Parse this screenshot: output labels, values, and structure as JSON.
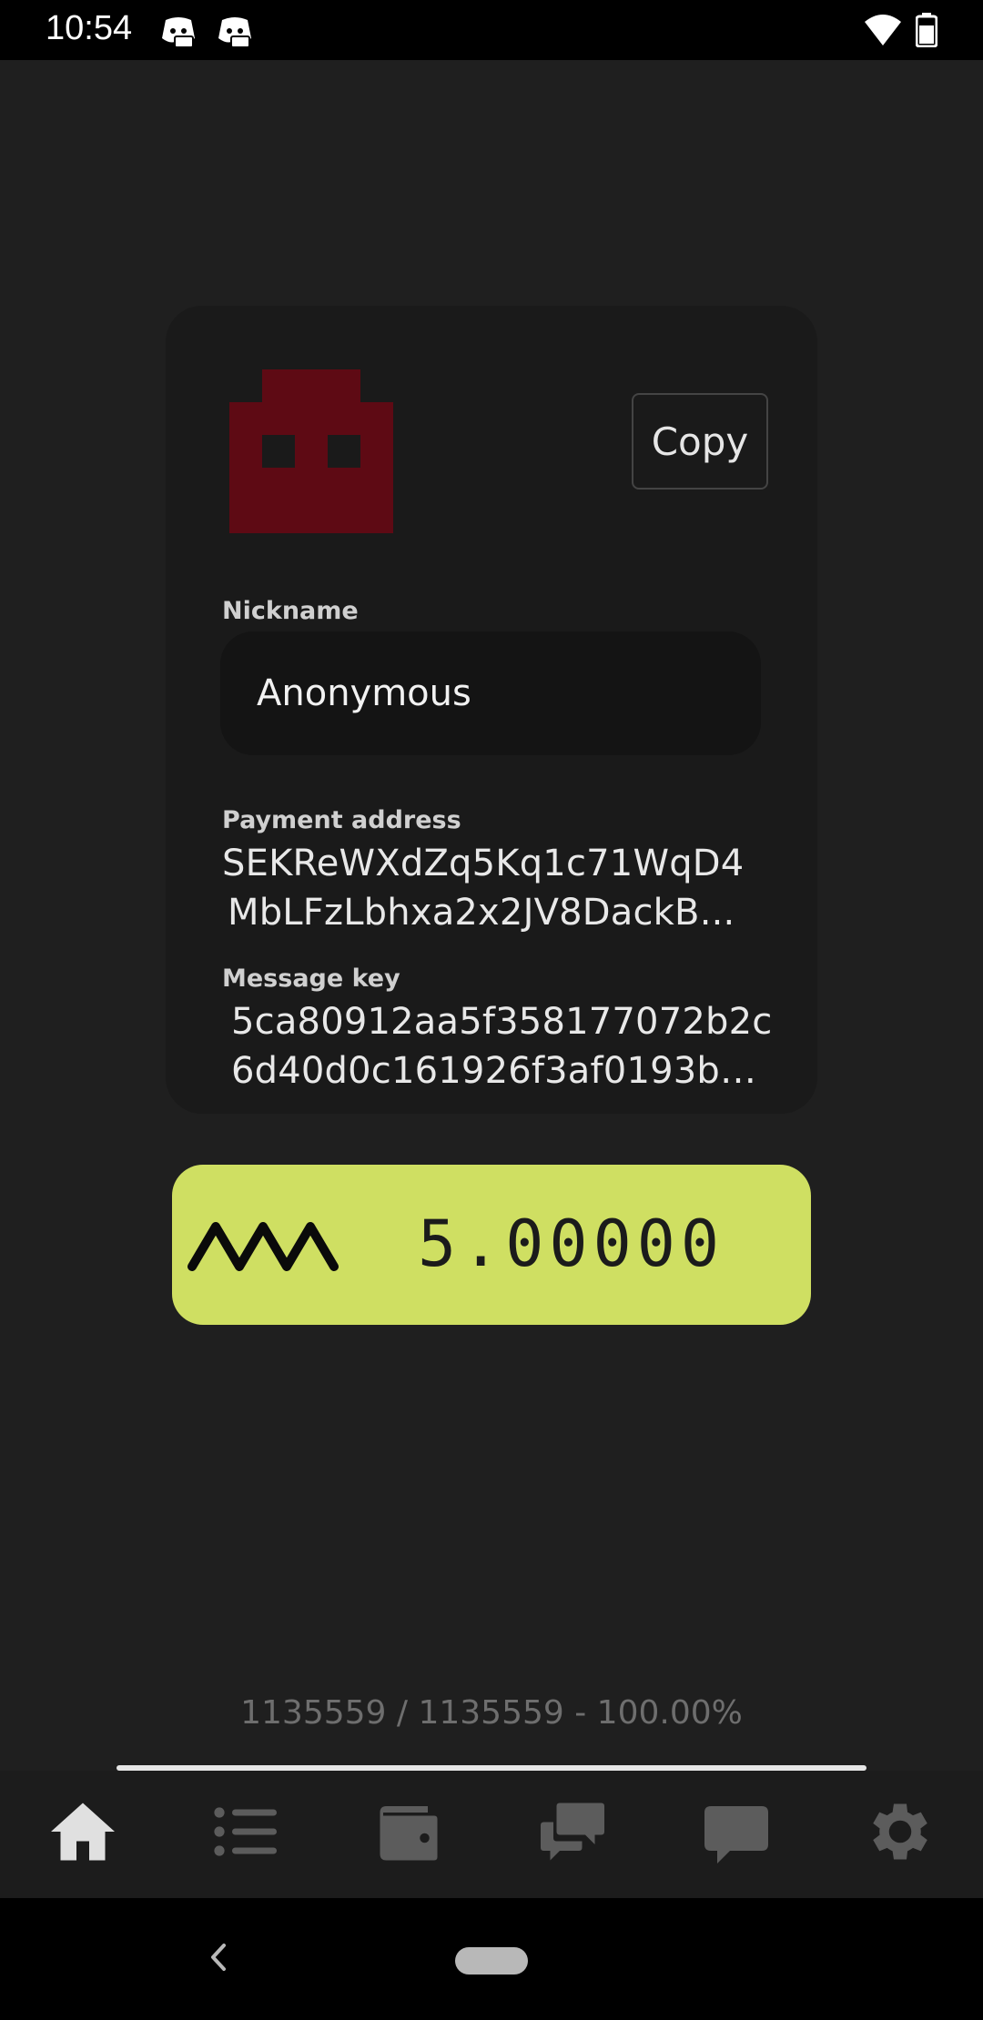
{
  "status_bar": {
    "time": "10:54",
    "icons": [
      "discord-icon",
      "discord-icon",
      "wifi-icon",
      "battery-icon"
    ]
  },
  "profile": {
    "copy_label": "Copy",
    "nickname_label": "Nickname",
    "nickname_value": "Anonymous",
    "payment_label": "Payment address",
    "payment_line1": "SEKReWXdZq5Kq1c71WqD4",
    "payment_line2": "MbLFzLbhxa2x2JV8DackB...",
    "message_label": "Message key",
    "message_line1": "5ca80912aa5f358177072b2c",
    "message_line2": "6d40d0c161926f3af0193b5...",
    "avatar_color": "#5e0a14"
  },
  "balance": {
    "amount": "5.00000",
    "background": "#cfdf62"
  },
  "sync": {
    "text": "1135559 / 1135559 - 100.00%",
    "progress": 1.0
  },
  "bottom_nav": {
    "items": [
      "home-icon",
      "list-icon",
      "wallet-icon",
      "chats-icon",
      "message-icon",
      "settings-icon"
    ],
    "active": "home-icon",
    "active_color": "#e0e0e0",
    "inactive_color": "#5c5c5c"
  }
}
